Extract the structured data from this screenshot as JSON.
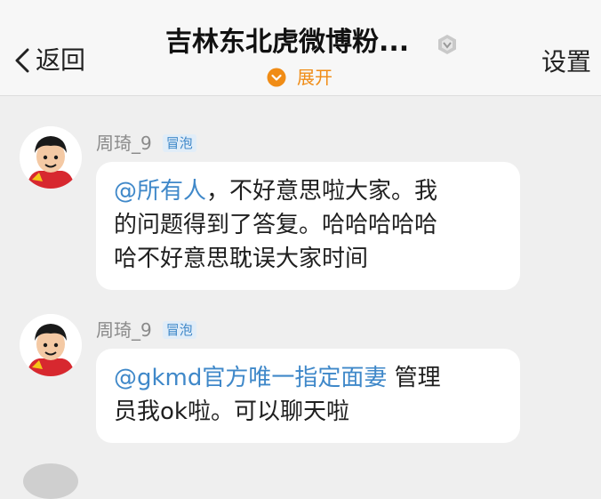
{
  "header": {
    "back_label": "返回",
    "title": "吉林东北虎微博粉...",
    "expand_label": "展开",
    "settings_label": "设置",
    "accent_color": "#f08c16"
  },
  "messages": [
    {
      "sender": "周琦_9",
      "tag": "冒泡",
      "mention": "@所有人",
      "text_lines": [
        "，不好意思啦大家。我",
        "的问题得到了答复。哈哈哈哈哈",
        "哈不好意思耽误大家时间"
      ]
    },
    {
      "sender": "周琦_9",
      "tag": "冒泡",
      "mention": "@gkmd官方唯一指定面妻",
      "text_lines": [
        " 管理",
        "员我ok啦。可以聊天啦"
      ]
    }
  ],
  "colors": {
    "mention": "#3f88c9",
    "background": "#efefef",
    "bubble": "#ffffff"
  }
}
